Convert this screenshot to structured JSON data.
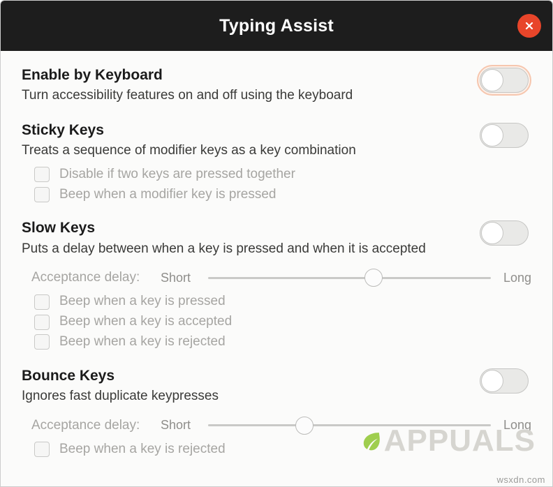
{
  "window": {
    "title": "Typing Assist",
    "close_icon": "close-icon"
  },
  "sections": [
    {
      "title": "Enable by Keyboard",
      "description": "Turn accessibility features on and off using the keyboard",
      "toggle": {
        "state": "off",
        "focused": true
      }
    },
    {
      "title": "Sticky Keys",
      "description": "Treats a sequence of modifier keys as a key combination",
      "toggle": {
        "state": "off",
        "focused": false
      },
      "checkboxes": [
        {
          "label": "Disable if two keys are pressed together",
          "checked": false
        },
        {
          "label": "Beep when a modifier key is pressed",
          "checked": false
        }
      ]
    },
    {
      "title": "Slow Keys",
      "description": "Puts a delay between when a key is pressed and when it is accepted",
      "toggle": {
        "state": "off",
        "focused": false
      },
      "slider": {
        "label": "Acceptance delay:",
        "min_label": "Short",
        "max_label": "Long",
        "value_percent": 59
      },
      "checkboxes": [
        {
          "label": "Beep when a key is pressed",
          "checked": false
        },
        {
          "label": "Beep when a key is accepted",
          "checked": false
        },
        {
          "label": "Beep when a key is rejected",
          "checked": false
        }
      ]
    },
    {
      "title": "Bounce Keys",
      "description": "Ignores fast duplicate keypresses",
      "toggle": {
        "state": "off",
        "focused": false
      },
      "slider": {
        "label": "Acceptance delay:",
        "min_label": "Short",
        "max_label": "Long",
        "value_percent": 33
      },
      "checkboxes": [
        {
          "label": "Beep when a key is rejected",
          "checked": false
        }
      ]
    }
  ],
  "watermarks": {
    "brand": "PPUALS",
    "brand_prefix": "A",
    "corner": "wsxdn.com"
  },
  "colors": {
    "titlebar_bg": "#1d1d1d",
    "close_button": "#e8452a",
    "body_bg": "#fbfbfa",
    "focus_ring": "#f6c6ae",
    "disabled_text": "#a6a5a2"
  }
}
